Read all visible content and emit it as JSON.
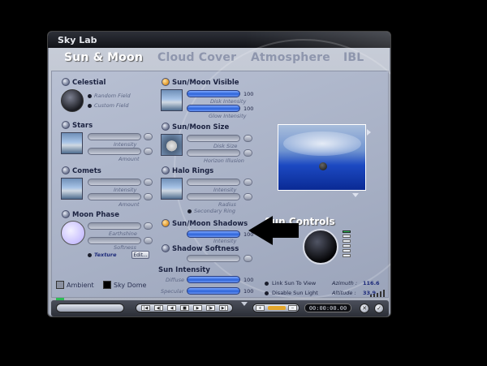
{
  "window": {
    "title": "Sky Lab"
  },
  "tabs": [
    {
      "label": "Sun & Moon",
      "active": true
    },
    {
      "label": "Cloud Cover",
      "active": false
    },
    {
      "label": "Atmosphere",
      "active": false
    },
    {
      "label": "IBL",
      "active": false
    }
  ],
  "left": {
    "celestial": {
      "title": "Celestial",
      "random_field": "Random Field",
      "custom_field": "Custom Field"
    },
    "stars": {
      "title": "Stars",
      "intensity": "Intensity",
      "amount": "Amount"
    },
    "comets": {
      "title": "Comets",
      "intensity": "Intensity",
      "amount": "Amount"
    },
    "moon_phase": {
      "title": "Moon Phase",
      "earthshine": "Earthshine",
      "softness": "Softness",
      "texture": "Texture",
      "edit": "Edit..."
    }
  },
  "middle": {
    "sun_moon_visible": {
      "title": "Sun/Moon Visible",
      "disk_intensity": "Disk Intensity",
      "disk_value": "100",
      "glow_intensity": "Glow Intensity",
      "glow_value": "100"
    },
    "sun_moon_size": {
      "title": "Sun/Moon Size",
      "disk_size": "Disk Size",
      "horizon_illusion": "Horizon Illusion"
    },
    "halo_rings": {
      "title": "Halo Rings",
      "intensity": "Intensity",
      "radius": "Radius",
      "secondary_ring": "Secondary Ring"
    },
    "sun_moon_shadows": {
      "title": "Sun/Moon Shadows",
      "intensity": "Intensity",
      "value": "100"
    },
    "shadow_softness": {
      "title": "Shadow Softness"
    },
    "sun_intensity": {
      "title": "Sun Intensity",
      "diffuse": "Diffuse",
      "diffuse_value": "100",
      "specular": "Specular",
      "specular_value": "100"
    }
  },
  "right": {
    "sun_controls": "Sun Controls",
    "link_sun": "Link Sun To View",
    "disable_sun": "Disable Sun Light",
    "azimuth_label": "Azimuth :",
    "azimuth_value": "116.6",
    "altitude_label": "Altitude :",
    "altitude_value": "33.9"
  },
  "footer": {
    "ambient": "Ambient",
    "sky_dome": "Sky Dome",
    "timecode": "00:00:00.00",
    "transport": [
      "|◀",
      "◀|",
      "◀",
      "■",
      "▶",
      "|▶",
      "▶|"
    ]
  },
  "colors": {
    "accent_blue": "#2d64d8",
    "radio_on": "#e39a2b",
    "title_bar": "#1b1d24",
    "sun_yellow": "#f4ea1a"
  }
}
